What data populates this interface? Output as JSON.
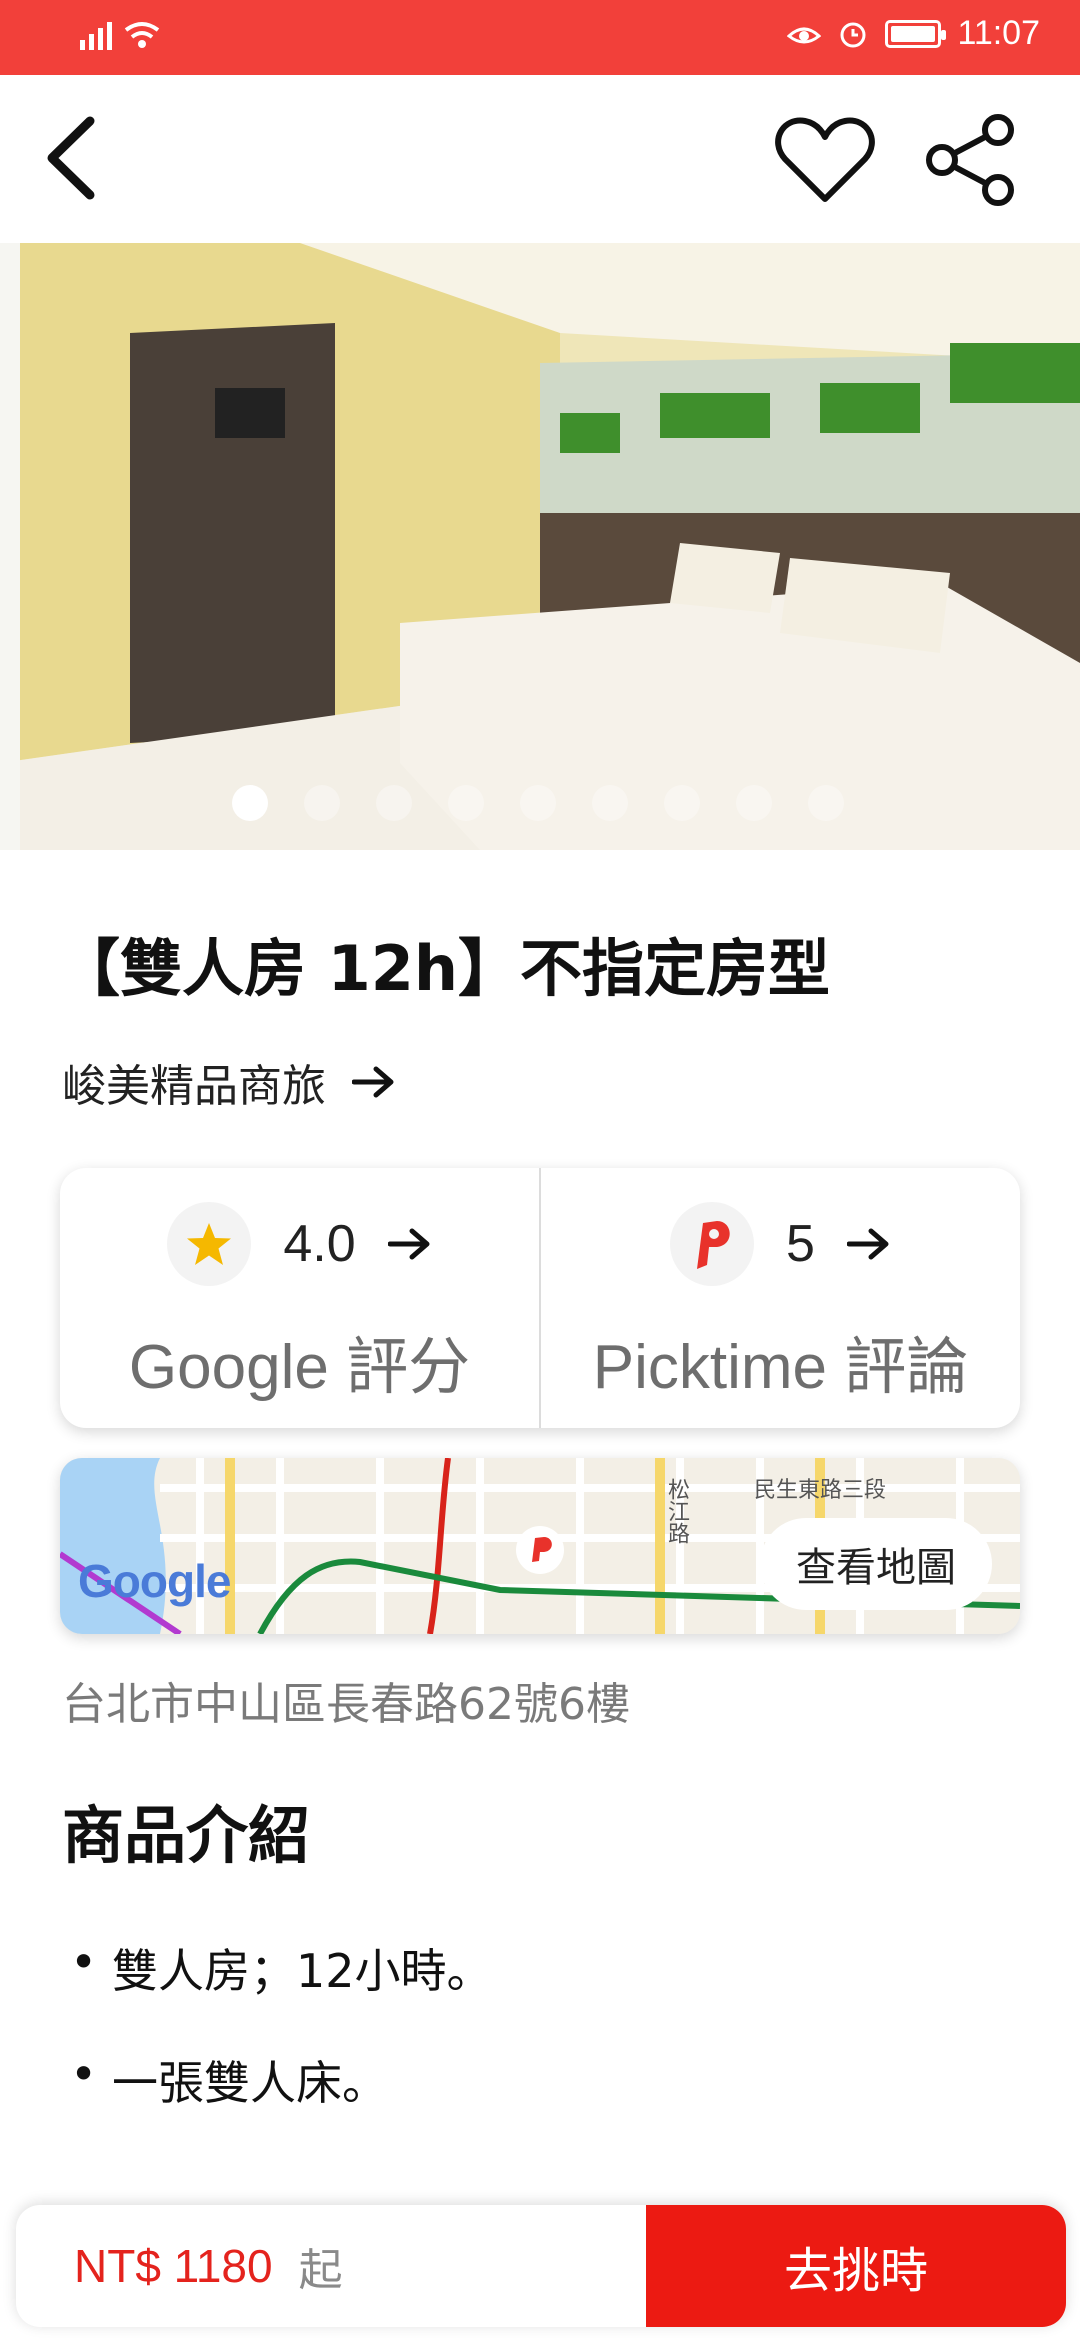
{
  "colors": {
    "accent": "#ec1a12",
    "status_bar": "#f2403a",
    "star": "#f5b800"
  },
  "status_bar": {
    "time": "11:07"
  },
  "nav": {
    "back_icon": "chevron-left-icon",
    "favorite_icon": "heart-icon",
    "share_icon": "share-icon"
  },
  "gallery": {
    "image": "hotel-room-photo",
    "dot_count": 9,
    "active_index": 0
  },
  "product": {
    "title": "【雙人房 12h】不指定房型",
    "hotel_name": "峻美精品商旅"
  },
  "ratings": {
    "google": {
      "value": "4.0",
      "label": "Google 評分"
    },
    "picktime": {
      "value": "5",
      "label": "Picktime 評論"
    }
  },
  "map": {
    "button_label": "查看地圖",
    "road_label_1": "民生東路三段",
    "road_label_2": "松江路",
    "logo_text": "Google"
  },
  "address": "台北市中山區長春路62號6樓",
  "description": {
    "heading": "商品介紹",
    "items": [
      "雙人房；12小時。",
      "一張雙人床。"
    ]
  },
  "footer": {
    "price": "NT$ 1180",
    "price_suffix": "起",
    "cta_label": "去挑時"
  }
}
